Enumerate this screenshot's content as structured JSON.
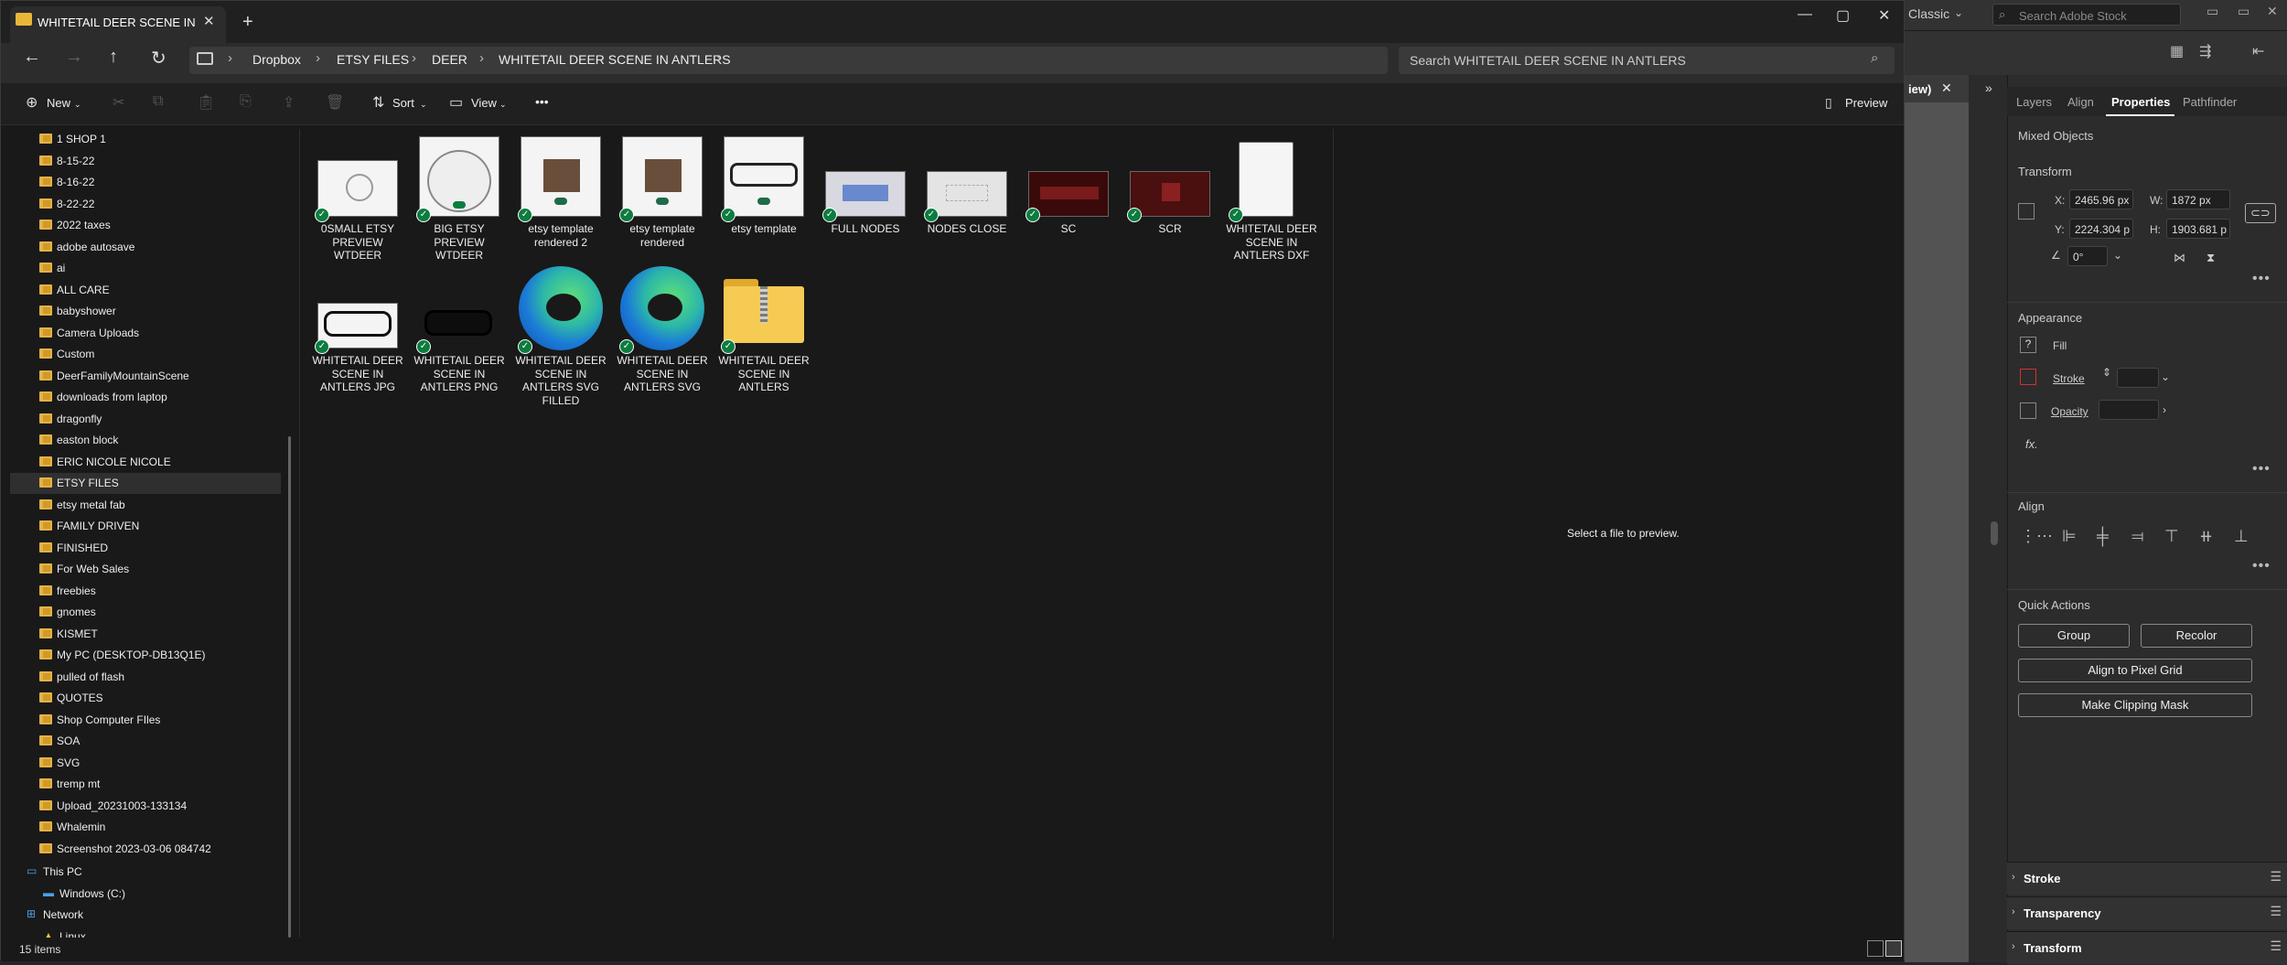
{
  "illustrator": {
    "workspace": "Classic",
    "stock_search_placeholder": "Search Adobe Stock",
    "doc_tab": "iew)",
    "panel_tabs": [
      "Layers",
      "Align",
      "Properties",
      "Pathfinder"
    ],
    "active_tab": "Properties",
    "selection_type": "Mixed Objects",
    "transform": {
      "heading": "Transform",
      "x_label": "X:",
      "x_value": "2465.96 px",
      "y_label": "Y:",
      "y_value": "2224.304 p",
      "w_label": "W:",
      "w_value": "1872 px",
      "h_label": "H:",
      "h_value": "1903.681 p",
      "angle_value": "0°"
    },
    "appearance": {
      "heading": "Appearance",
      "fill": "Fill",
      "stroke": "Stroke",
      "opacity": "Opacity",
      "fx": "fx."
    },
    "align": {
      "heading": "Align"
    },
    "quick_actions": {
      "heading": "Quick Actions",
      "group": "Group",
      "recolor": "Recolor",
      "align_pixel_grid": "Align to Pixel Grid",
      "clipping_mask": "Make Clipping Mask"
    },
    "bottom_panels": [
      "Stroke",
      "Transparency",
      "Transform"
    ]
  },
  "explorer": {
    "tab_title": "WHITETAIL DEER SCENE IN ANTLERS",
    "breadcrumb": [
      "Dropbox",
      "ETSY FILES",
      "DEER",
      "WHITETAIL DEER SCENE IN ANTLERS"
    ],
    "search_placeholder": "Search WHITETAIL DEER SCENE IN ANTLERS",
    "toolbar": {
      "new": "New",
      "sort": "Sort",
      "view": "View",
      "more": "•••",
      "preview": "Preview"
    },
    "sidebar": [
      "1 SHOP 1",
      "8-15-22",
      "8-16-22",
      "8-22-22",
      "2022 taxes",
      "adobe autosave",
      "ai",
      "ALL CARE",
      "babyshower",
      "Camera Uploads",
      "Custom",
      "DeerFamilyMountainScene",
      "downloads from laptop",
      "dragonfly",
      "easton block",
      "ERIC NICOLE NICOLE",
      "ETSY FILES",
      "etsy metal fab",
      "FAMILY DRIVEN",
      "FINISHED",
      "For Web Sales",
      "freebies",
      "gnomes",
      "KISMET",
      "My PC (DESKTOP-DB13Q1E)",
      "pulled of flash",
      "QUOTES",
      "Shop Computer FIles",
      "SOA",
      "SVG",
      "tremp mt",
      "Upload_20231003-133134",
      "Whalemin",
      "Screenshot 2023-03-06 084742"
    ],
    "sidebar_selected": "ETSY FILES",
    "sidebar_roots": {
      "this_pc": "This PC",
      "windows_c": "Windows (C:)",
      "network": "Network",
      "linux": "Linux"
    },
    "files": [
      {
        "name": "0SMALL ETSY PREVIEW WTDEER",
        "kind": "preview-small"
      },
      {
        "name": "BIG ETSY PREVIEW WTDEER",
        "kind": "preview-big"
      },
      {
        "name": "etsy template rendered 2",
        "kind": "template"
      },
      {
        "name": "etsy template rendered",
        "kind": "template"
      },
      {
        "name": "etsy template",
        "kind": "template-dark"
      },
      {
        "name": "FULL NODES",
        "kind": "screenshot-blue"
      },
      {
        "name": "NODES CLOSE",
        "kind": "screenshot-white"
      },
      {
        "name": "SC",
        "kind": "screenshot-red"
      },
      {
        "name": "SCR",
        "kind": "screenshot-red2"
      },
      {
        "name": "WHITETAIL DEER SCENE IN ANTLERS DXF",
        "kind": "blank-doc"
      },
      {
        "name": "WHITETAIL DEER SCENE IN ANTLERS JPG",
        "kind": "antler-white"
      },
      {
        "name": "WHITETAIL DEER SCENE IN ANTLERS PNG",
        "kind": "antler-black"
      },
      {
        "name": "WHITETAIL DEER SCENE IN ANTLERS SVG FILLED",
        "kind": "edge"
      },
      {
        "name": "WHITETAIL DEER SCENE IN ANTLERS SVG",
        "kind": "edge"
      },
      {
        "name": "WHITETAIL DEER SCENE IN ANTLERS",
        "kind": "zip"
      }
    ],
    "preview_message": "Select a file to preview.",
    "status": "15 items"
  }
}
